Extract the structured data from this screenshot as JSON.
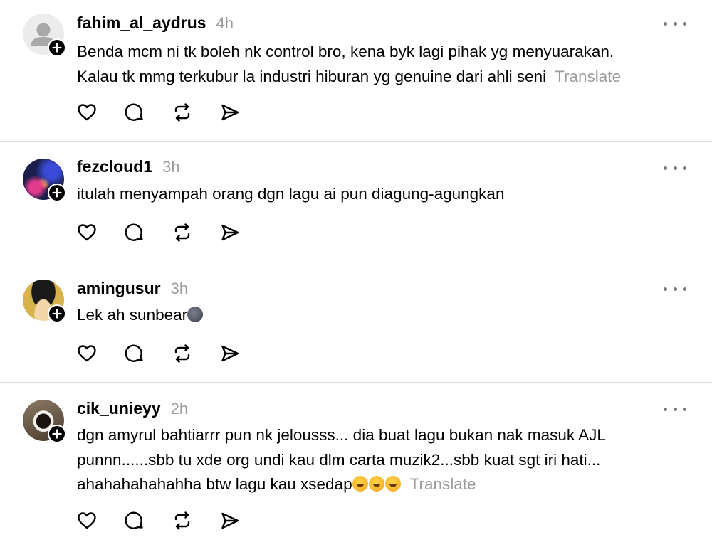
{
  "posts": [
    {
      "username": "fahim_al_aydrus",
      "time": "4h",
      "avatar": "default-person-avatar",
      "text_lines": [
        "Benda mcm ni tk boleh nk control bro, kena byk lagi pihak yg menyuarakan.",
        "Kalau tk mmg terkubur la industri hiburan yg genuine dari ahli seni"
      ],
      "translate": "Translate"
    },
    {
      "username": "fezcloud1",
      "time": "3h",
      "avatar": "concert-lights-avatar",
      "text_lines": [
        "itulah menyampah orang dgn lagu ai pun diagung-agungkan"
      ]
    },
    {
      "username": "amingusur",
      "time": "3h",
      "avatar": "anime-character-avatar",
      "text_lines": [
        "Lek ah sunbear"
      ],
      "emoji": "new-moon-face-emoji"
    },
    {
      "username": "cik_unieyy",
      "time": "2h",
      "avatar": "coffee-cup-avatar",
      "text_lines": [
        "dgn amyrul bahtiarrr pun nk jelousss... dia buat lagu bukan nak masuk AJL",
        "punnn......sbb tu xde org undi kau dlm carta muzik2...sbb kuat sgt iri hati...",
        "ahahahahahahha btw lagu kau xsedap"
      ],
      "emoji": "rolling-on-floor-laughing-emoji x3",
      "translate": "Translate"
    }
  ],
  "colors": {
    "text": "#000000",
    "muted": "#9b9b9b",
    "divider": "#dcdcdc",
    "icon": "#000000"
  },
  "action_icons": [
    "heart-icon",
    "comment-icon",
    "repost-icon",
    "share-icon"
  ]
}
